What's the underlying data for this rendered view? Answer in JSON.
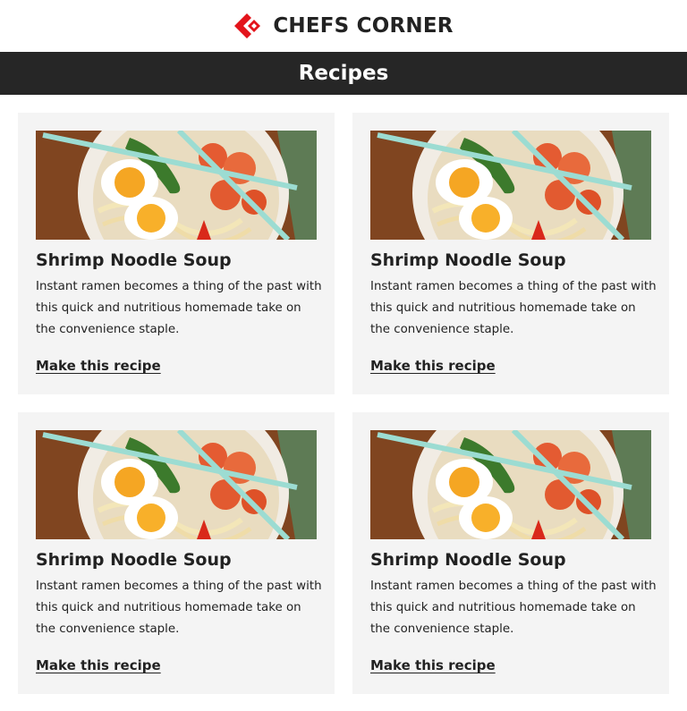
{
  "brand": {
    "name": "CHEFS CORNER",
    "logo_icon": "chevron-diamond-logo",
    "accent_color": "#e3141b"
  },
  "header": {
    "title": "Recipes",
    "background": "#262626"
  },
  "cards": [
    {
      "image_icon": "ramen-bowl-image",
      "title": "Shrimp Noodle Soup",
      "description": "Instant ramen becomes a thing of the past with this quick and nutritious homemade take on the convenience staple.",
      "link_label": "Make this recipe"
    },
    {
      "image_icon": "ramen-bowl-image",
      "title": "Shrimp Noodle Soup",
      "description": "Instant ramen becomes a thing of the past with this quick and nutritious homemade take on the convenience staple.",
      "link_label": "Make this recipe"
    },
    {
      "image_icon": "ramen-bowl-image",
      "title": "Shrimp Noodle Soup",
      "description": "Instant ramen becomes a thing of the past with this quick and nutritious homemade take on the convenience staple.",
      "link_label": "Make this recipe"
    },
    {
      "image_icon": "ramen-bowl-image",
      "title": "Shrimp Noodle Soup",
      "description": "Instant ramen becomes a thing of the past with this quick and nutritious homemade take on the convenience staple.",
      "link_label": "Make this recipe"
    }
  ]
}
